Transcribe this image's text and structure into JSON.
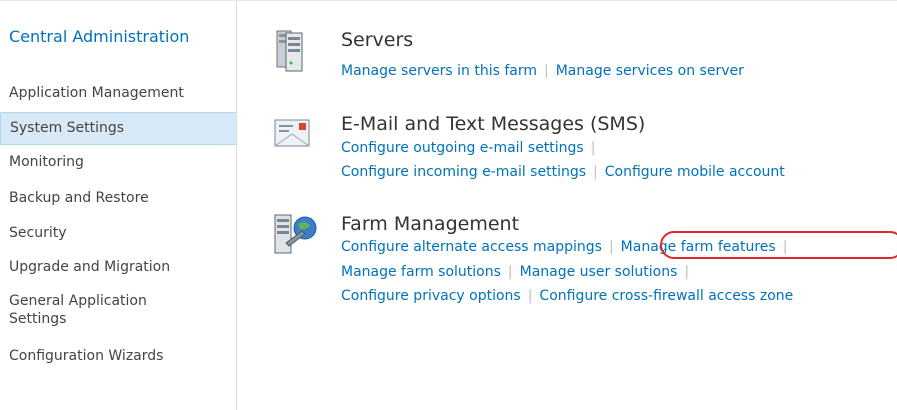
{
  "sidebar": {
    "title": "Central Administration",
    "items": [
      {
        "label": "Application Management",
        "selected": false
      },
      {
        "label": "System Settings",
        "selected": true
      },
      {
        "label": "Monitoring",
        "selected": false
      },
      {
        "label": "Backup and Restore",
        "selected": false
      },
      {
        "label": "Security",
        "selected": false
      },
      {
        "label": "Upgrade and Migration",
        "selected": false
      },
      {
        "label": "General Application Settings",
        "selected": false
      },
      {
        "label": "Configuration Wizards",
        "selected": false
      }
    ]
  },
  "sections": {
    "servers": {
      "title": "Servers",
      "icon": "server-icon",
      "links": [
        "Manage servers in this farm",
        "Manage services on server"
      ]
    },
    "email": {
      "title": "E-Mail and Text Messages (SMS)",
      "icon": "email-envelope-icon",
      "links": [
        "Configure outgoing e-mail settings",
        "Configure incoming e-mail settings",
        "Configure mobile account"
      ]
    },
    "farm": {
      "title": "Farm Management",
      "icon": "farm-management-icon",
      "links": [
        "Configure alternate access mappings",
        "Manage farm features",
        "Manage farm solutions",
        "Manage user solutions",
        "Configure privacy options",
        "Configure cross-firewall access zone"
      ]
    }
  },
  "colors": {
    "link": "#0072bc",
    "selected_bg": "#d7e9f7",
    "highlight_ring": "#e0282d"
  }
}
